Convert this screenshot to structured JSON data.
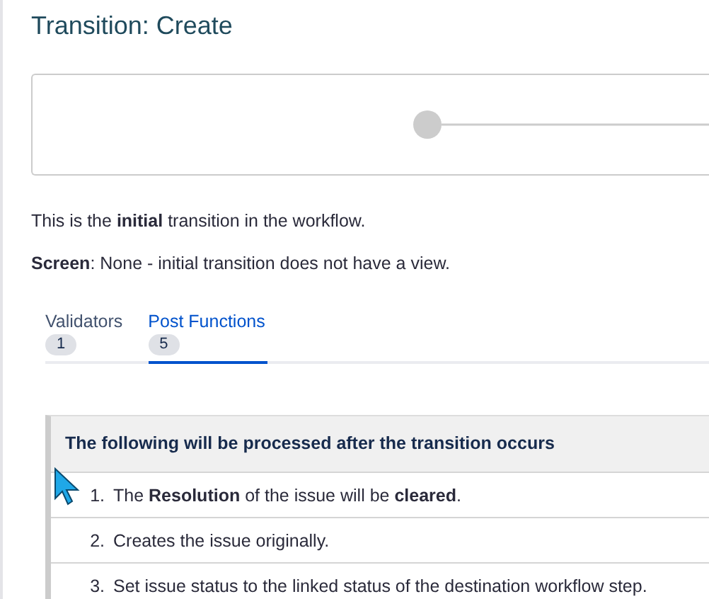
{
  "page": {
    "title": "Transition: Create"
  },
  "description": "This is the **initial** transition in the workflow.",
  "screen_line": "**Screen**: None - initial transition does not have a view.",
  "tabs": [
    {
      "label": "Validators",
      "count": "1",
      "selected": false
    },
    {
      "label": "Post Functions",
      "count": "5",
      "selected": true
    }
  ],
  "table": {
    "header": "The following will be processed after the transition occurs",
    "rows": [
      {
        "number": "1.",
        "text": "The **Resolution** of the issue will be **cleared**."
      },
      {
        "number": "2.",
        "text": "Creates the issue originally."
      },
      {
        "number": "3.",
        "text": "Set issue status to the linked status of the destination workflow step."
      }
    ]
  }
}
